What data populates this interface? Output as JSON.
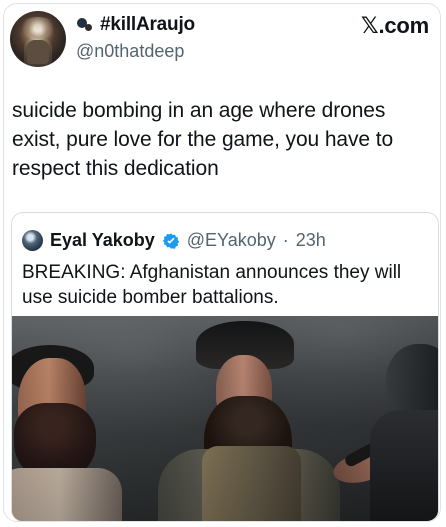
{
  "post": {
    "author_name": "#killAraujo",
    "author_handle": "@n0thatdeep",
    "site_label": "𝕏.com",
    "text": "suicide bombing in an age where drones\nexist, pure love for the game, you have to\nrespect this dedication"
  },
  "quoted": {
    "author_name": "Eyal Yakoby",
    "author_handle": "@EYakoby",
    "separator": "·",
    "time": "23h",
    "text": "BREAKING: Afghanistan announces they will\nuse suicide bomber battalions."
  },
  "colors": {
    "text_primary": "#0f1419",
    "text_secondary": "#536471",
    "verified_blue": "#1d9bf0",
    "border": "#dfe3e6"
  },
  "icons": {
    "author_avatar": "avatar",
    "author_emoji": "headphones-icon",
    "brand_icon": "x-logo-icon",
    "quoted_avatar": "avatar",
    "verified_badge": "verified-icon"
  }
}
